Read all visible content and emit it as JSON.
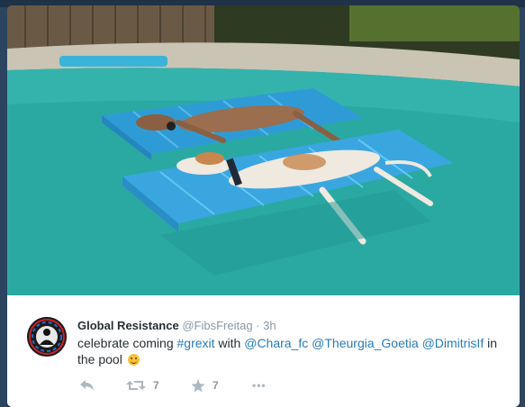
{
  "tweet": {
    "display_name": "Global Resistance",
    "handle": "@FibsFreitag",
    "separator": "·",
    "time": "3h",
    "text_start": "celebrate coming ",
    "hashtag": "#grexit",
    "text_mid": " with ",
    "mention_1": "@Chara_fc",
    "mention_2": "@Theurgia_Goetia",
    "mention_3": "@DimitrisIf",
    "text_end": " in the pool"
  },
  "actions": {
    "retweet_count": "7",
    "favorite_count": "7",
    "more_label": "•••"
  },
  "icons": {
    "reply": "reply-icon",
    "retweet": "retweet-icon",
    "favorite": "star-icon",
    "more": "more-icon"
  },
  "colors": {
    "link": "#2b7bb9",
    "muted": "#8899a6",
    "name": "#292f33",
    "pool_water": "#2aa9a2",
    "float": "#3aa8e0"
  }
}
